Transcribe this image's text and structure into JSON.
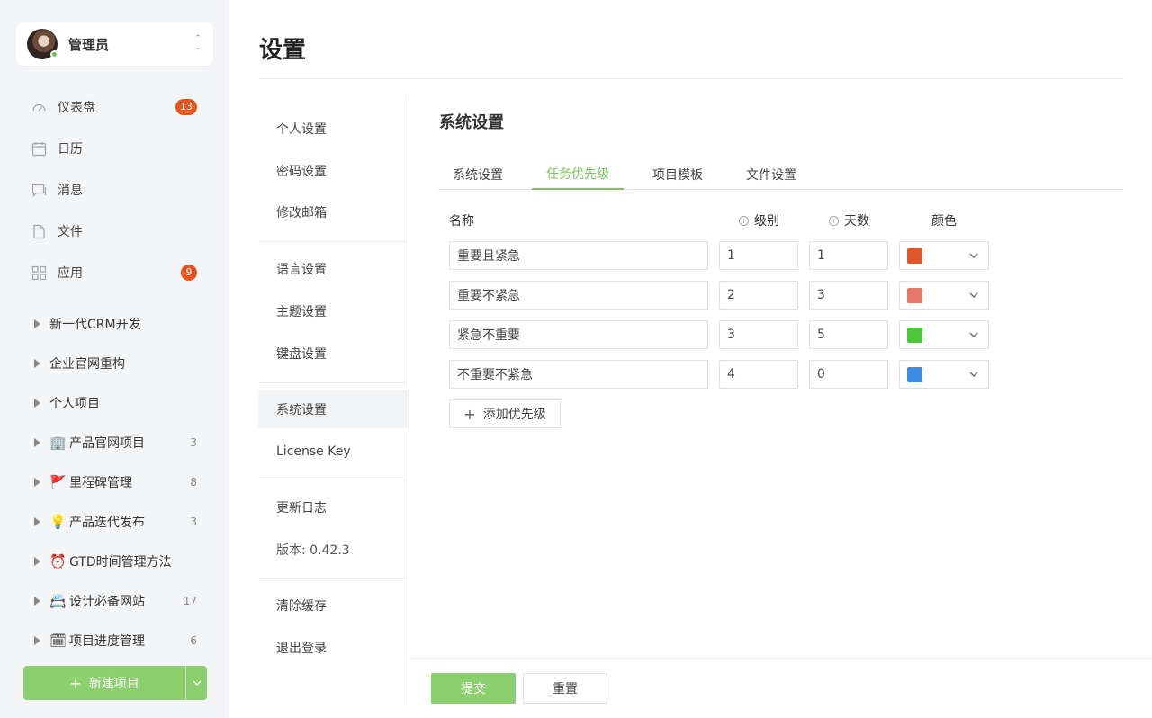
{
  "user": {
    "name": "管理员",
    "status": "online"
  },
  "nav": [
    {
      "label": "仪表盘",
      "icon": "dashboard-icon",
      "badge": "13"
    },
    {
      "label": "日历",
      "icon": "calendar-icon"
    },
    {
      "label": "消息",
      "icon": "message-icon"
    },
    {
      "label": "文件",
      "icon": "file-icon"
    },
    {
      "label": "应用",
      "icon": "apps-icon",
      "badge": "9"
    }
  ],
  "projects": [
    {
      "label": "新一代CRM开发",
      "emoji": "",
      "count": ""
    },
    {
      "label": "企业官网重构",
      "emoji": "",
      "count": ""
    },
    {
      "label": "个人项目",
      "emoji": "",
      "count": ""
    },
    {
      "label": "产品官网项目",
      "emoji": "🏢",
      "count": "3"
    },
    {
      "label": "里程碑管理",
      "emoji": "🚩",
      "count": "8"
    },
    {
      "label": "产品迭代发布",
      "emoji": "💡",
      "count": "3"
    },
    {
      "label": "GTD时间管理方法",
      "emoji": "⏰",
      "count": ""
    },
    {
      "label": "设计必备网站",
      "emoji": "📇",
      "count": "17"
    },
    {
      "label": "项目进度管理",
      "emoji": "🗓",
      "count": "6"
    }
  ],
  "new_project_label": "新建项目",
  "page_title": "设置",
  "settings_menu": [
    "个人设置",
    "密码设置",
    "修改邮箱",
    "语言设置",
    "主题设置",
    "键盘设置",
    "系统设置",
    "License Key",
    "更新日志",
    "版本: 0.42.3",
    "清除缓存",
    "退出登录"
  ],
  "settings_menu_active": "系统设置",
  "content_title": "系统设置",
  "tabs": [
    {
      "label": "系统设置",
      "active": false
    },
    {
      "label": "任务优先级",
      "active": true
    },
    {
      "label": "项目模板",
      "active": false
    },
    {
      "label": "文件设置",
      "active": false
    }
  ],
  "table_headers": {
    "name": "名称",
    "level": "级别",
    "days": "天数",
    "color": "颜色"
  },
  "priorities": [
    {
      "name": "重要且紧急",
      "level": "1",
      "days": "1",
      "color": "#e2542a"
    },
    {
      "name": "重要不紧急",
      "level": "2",
      "days": "3",
      "color": "#e8776a"
    },
    {
      "name": "紧急不重要",
      "level": "3",
      "days": "5",
      "color": "#4fc637"
    },
    {
      "name": "不重要不紧急",
      "level": "4",
      "days": "0",
      "color": "#3c8ce6"
    }
  ],
  "add_priority_label": "添加优先级",
  "submit_label": "提交",
  "reset_label": "重置",
  "accent_color": "#7cc35c"
}
